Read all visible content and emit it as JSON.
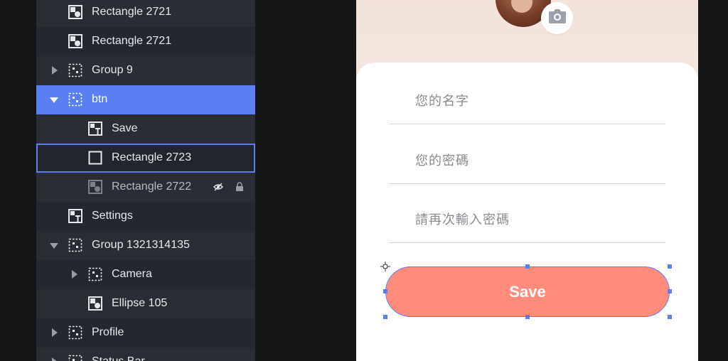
{
  "layers": [
    {
      "label": "Rectangle 2721",
      "icon": "image-layer-icon",
      "caret": "none",
      "state": "normal"
    },
    {
      "label": "Rectangle 2721",
      "icon": "image-layer-icon",
      "caret": "none",
      "state": "normal"
    },
    {
      "label": "Group 9",
      "icon": "group-icon",
      "caret": "collapsed",
      "state": "normal"
    },
    {
      "label": "btn",
      "icon": "group-icon",
      "caret": "expanded",
      "state": "selected"
    },
    {
      "label": "Save",
      "icon": "text-layer-icon",
      "caret": "none",
      "state": "normal"
    },
    {
      "label": "Rectangle 2723",
      "icon": "rectangle-icon",
      "caret": "none",
      "state": "hovered"
    },
    {
      "label": "Rectangle 2722",
      "icon": "image-layer-icon",
      "caret": "none",
      "state": "hidden-locked"
    },
    {
      "label": "Settings",
      "icon": "text-layer-icon",
      "caret": "none",
      "state": "normal"
    },
    {
      "label": "Group 1321314135",
      "icon": "group-icon",
      "caret": "expanded",
      "state": "normal"
    },
    {
      "label": "Camera",
      "icon": "group-icon",
      "caret": "collapsed",
      "state": "normal"
    },
    {
      "label": "Ellipse 105",
      "icon": "image-layer-icon",
      "caret": "none",
      "state": "normal"
    },
    {
      "label": "Profile",
      "icon": "group-icon",
      "caret": "collapsed",
      "state": "normal"
    },
    {
      "label": "Status Bar",
      "icon": "group-icon",
      "caret": "collapsed",
      "state": "normal"
    }
  ],
  "form": {
    "name_placeholder": "您的名字",
    "password_placeholder": "您的密碼",
    "confirm_placeholder": "請再次輸入密碼",
    "save_label": "Save"
  },
  "colors": {
    "accent": "#5a7ff3",
    "button": "#ff8b7b",
    "panel": "#262830"
  }
}
